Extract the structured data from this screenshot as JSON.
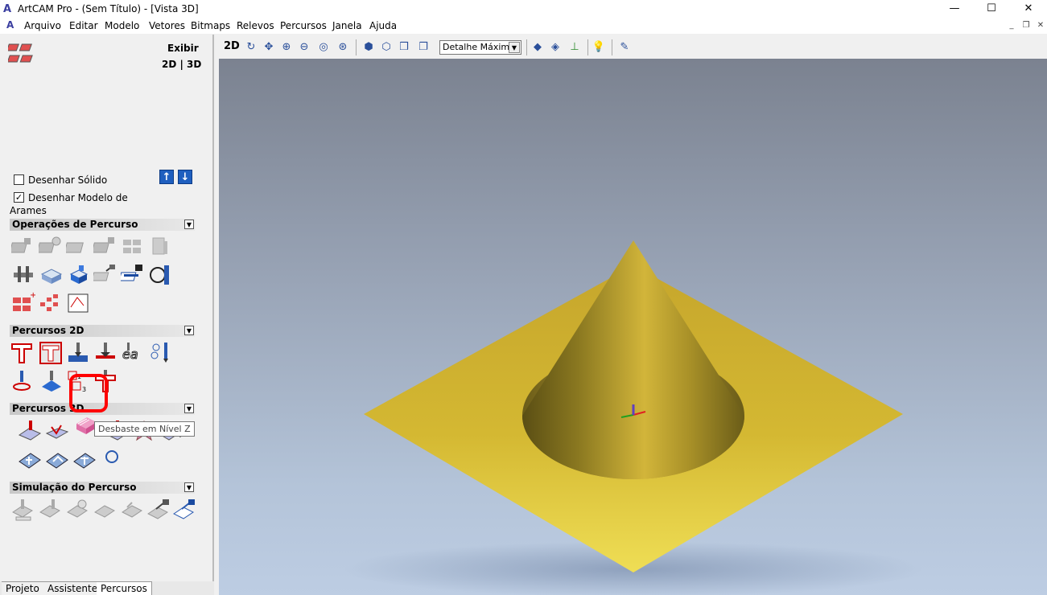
{
  "window": {
    "title": "ArtCAM Pro - (Sem Título) - [Vista 3D]",
    "minimize": "—",
    "maximize": "☐",
    "close": "✕"
  },
  "menu": {
    "items": [
      "Arquivo",
      "Editar",
      "Modelo",
      "Vetores",
      "Bitmaps",
      "Relevos",
      "Percursos",
      "Janela",
      "Ajuda"
    ]
  },
  "left_panel": {
    "exibir": "Exibir",
    "view_2d3d": "2D | 3D",
    "draw_solid": {
      "label": "Desenhar Sólido",
      "checked": false
    },
    "draw_wireframe": {
      "label": "Desenhar Modelo de Arames",
      "checked": true
    },
    "sections": {
      "operations": "Operações de Percurso",
      "paths2d": "Percursos 2D",
      "paths3d": "Percursos 3D",
      "simulation": "Simulação do Percurso"
    },
    "tooltip": "Desbaste em Nível Z",
    "tabs": [
      "Projeto",
      "Assistente",
      "Percursos"
    ],
    "active_tab": "Percursos"
  },
  "toolbar": {
    "mode_label": "2D",
    "detail_select": "Detalhe Máximo"
  },
  "colors": {
    "accent_blue": "#1f5fbf",
    "cone_gold": "#c8a832",
    "highlight_red": "#ff0000"
  }
}
